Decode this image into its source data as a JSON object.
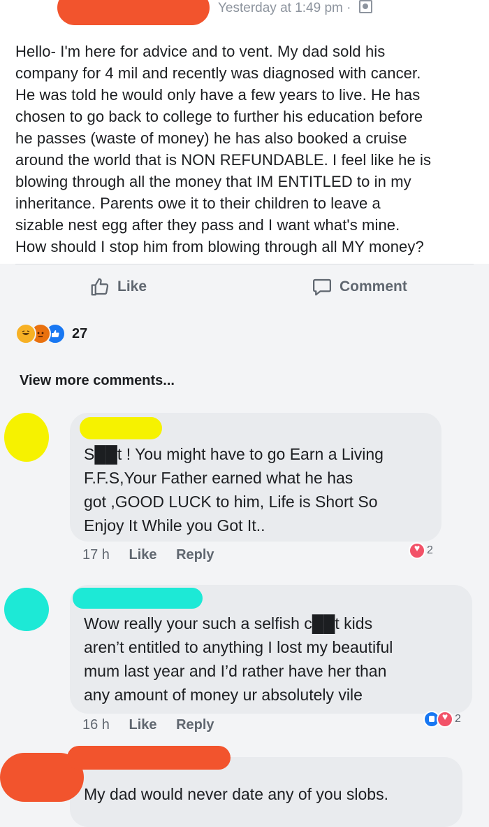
{
  "post": {
    "timestamp": "Yesterday at 1:49 pm",
    "separator": "·",
    "audience_icon": "friends-icon",
    "text_lines": [
      "Hello- I'm here for advice and to vent. My dad sold his",
      "company for 4 mil and recently was diagnosed with cancer.",
      "He was told he would only have a few years to live. He has",
      "chosen to go back to college to further his education before",
      "he passes (waste of money) he has also booked a cruise",
      "around the world that is NON REFUNDABLE. I feel like he is",
      "blowing through all the money that IM ENTITLED to in my",
      "inheritance. Parents owe it to their children to leave a",
      "sizable nest egg after they pass and I want what's mine.",
      "How should I stop him from blowing through all MY money?"
    ],
    "like_label": "Like",
    "comment_label": "Comment",
    "reaction_count": "27",
    "view_more": "View more comments..."
  },
  "comments": [
    {
      "lines": [
        "S██t ! You might have to go Earn a Living",
        "F.F.S,Your Father earned what he has",
        "got ,GOOD LUCK to him, Life is Short So",
        "Enjoy It While you Got It.."
      ],
      "time": "17 h",
      "like": "Like",
      "reply": "Reply",
      "reactions": "2"
    },
    {
      "lines": [
        "Wow really your such a selfish c██t kids",
        "aren’t entitled to anything I lost my beautiful",
        "mum last year and I’d rather have her than",
        "any amount of money ur absolutely vile"
      ],
      "time": "16 h",
      "like": "Like",
      "reply": "Reply",
      "reactions": "2"
    },
    {
      "lines": [
        "My dad would never date any of you slobs."
      ]
    }
  ],
  "colors": {
    "redaction_orange": "#f2542d",
    "redaction_yellow": "#f6f200",
    "redaction_cyan": "#1de9d6",
    "facebook_blue": "#1877f2",
    "love_red": "#f25268"
  }
}
